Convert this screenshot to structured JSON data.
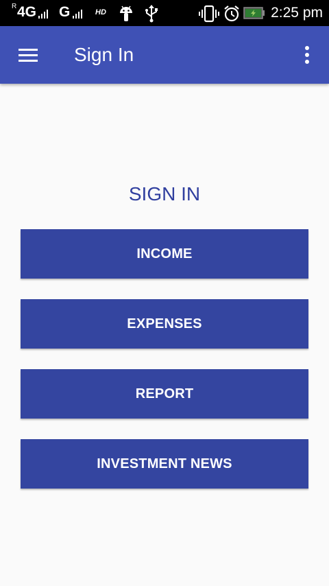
{
  "status_bar": {
    "roaming_indicator": "R",
    "network_primary": "4G",
    "network_secondary": "G",
    "hd_label": "HD",
    "time": "2:25 pm",
    "icons": [
      "android-debug-icon",
      "usb-icon",
      "vibrate-icon",
      "alarm-icon",
      "battery-charging-icon"
    ]
  },
  "app_bar": {
    "title": "Sign In",
    "menu_icon": "hamburger-menu-icon",
    "overflow_icon": "more-vert-icon",
    "color": "#3f51b5"
  },
  "main": {
    "heading": "SIGN IN",
    "buttons": [
      {
        "label": "INCOME"
      },
      {
        "label": "EXPENSES"
      },
      {
        "label": "REPORT"
      },
      {
        "label": "INVESTMENT NEWS"
      }
    ],
    "button_color": "#3445a0",
    "heading_color": "#303f9f"
  }
}
